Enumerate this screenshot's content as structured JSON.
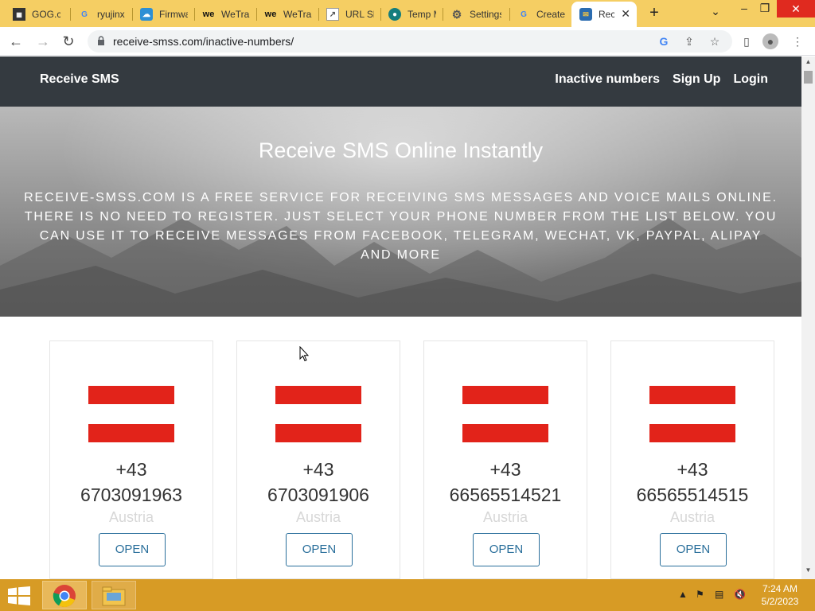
{
  "browser": {
    "tabs": [
      {
        "label": "GOG.com",
        "icon": "grid-favicon"
      },
      {
        "label": "ryujinx",
        "icon": "google-favicon"
      },
      {
        "label": "Firmware",
        "icon": "cloud-favicon"
      },
      {
        "label": "WeTransfer",
        "icon": "we-favicon"
      },
      {
        "label": "WeTransfer",
        "icon": "we-favicon"
      },
      {
        "label": "URL Shortener",
        "icon": "link-favicon"
      },
      {
        "label": "Temp Mail",
        "icon": "circle-favicon"
      },
      {
        "label": "Settings",
        "icon": "gear-favicon"
      },
      {
        "label": "Create",
        "icon": "google-favicon"
      },
      {
        "label": "Receive SMS",
        "icon": "sms-favicon",
        "active": true
      }
    ],
    "url": "receive-smss.com/inactive-numbers/"
  },
  "site": {
    "brand": "Receive SMS",
    "nav": [
      "Inactive numbers",
      "Sign Up",
      "Login"
    ],
    "hero": {
      "title": "Receive SMS Online Instantly",
      "subtitle": "RECEIVE-SMSS.COM IS A FREE SERVICE FOR RECEIVING SMS MESSAGES AND VOICE MAILS ONLINE. THERE IS NO NEED TO REGISTER. JUST SELECT YOUR PHONE NUMBER FROM THE LIST BELOW. YOU CAN USE IT TO RECEIVE MESSAGES FROM FACEBOOK, TELEGRAM, WECHAT, VK, PAYPAL, ALIPAY AND MORE"
    },
    "numbers": [
      {
        "code": "+43",
        "number": "6703091963",
        "country": "Austria",
        "button": "OPEN"
      },
      {
        "code": "+43",
        "number": "6703091906",
        "country": "Austria",
        "button": "OPEN"
      },
      {
        "code": "+43",
        "number": "66565514521",
        "country": "Austria",
        "button": "OPEN"
      },
      {
        "code": "+43",
        "number": "66565514515",
        "country": "Austria",
        "button": "OPEN"
      }
    ]
  },
  "taskbar": {
    "time": "7:24 AM",
    "date": "5/2/2023"
  },
  "colors": {
    "tabstrip": "#f5ce63",
    "navbar": "#343a40",
    "flag_red": "#e2231a",
    "button_blue": "#2a6f9b",
    "taskbar": "#d79b25"
  }
}
